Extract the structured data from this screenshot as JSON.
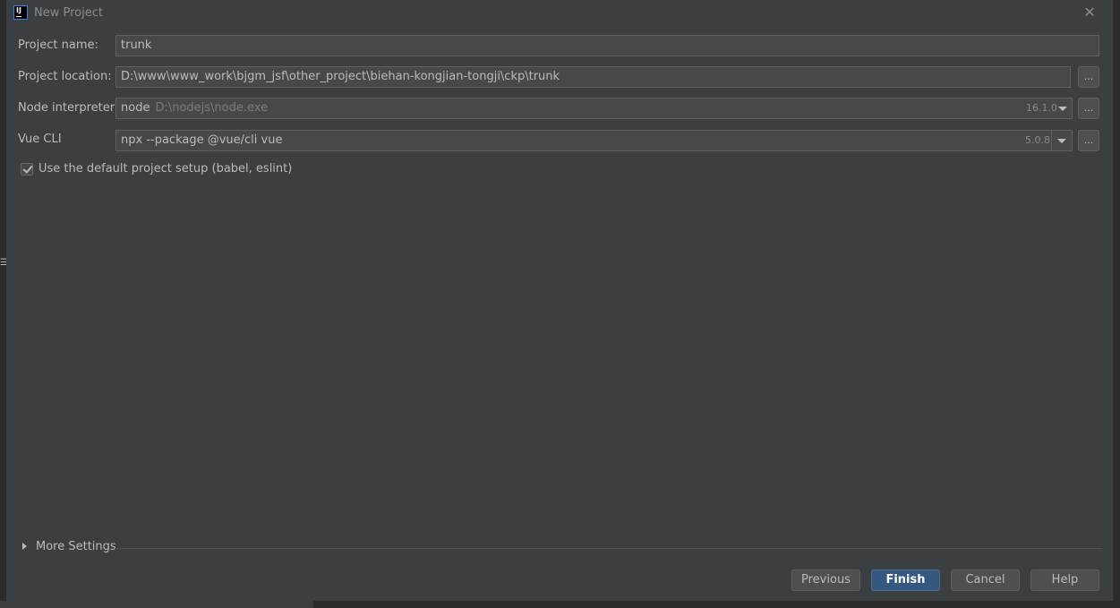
{
  "window": {
    "title": "New Project",
    "app_icon_text": "IJ"
  },
  "form": {
    "project_name": {
      "label": "Project name:",
      "value": "trunk"
    },
    "project_location": {
      "label": "Project location:",
      "value": "D:\\www\\www_work\\bjgm_jsf\\other_project\\biehan-kongjian-tongji\\ckp\\trunk",
      "browse_label": "..."
    },
    "node_interpreter": {
      "label": "Node interpreter:",
      "name": "node",
      "path": "D:\\nodejs\\node.exe",
      "version": "16.1.0",
      "browse_label": "..."
    },
    "vue_cli": {
      "label": "Vue CLI",
      "value": "npx --package @vue/cli vue",
      "version": "5.0.8",
      "browse_label": "..."
    },
    "default_setup": {
      "label": "Use the default project setup (babel, eslint)",
      "checked": true
    }
  },
  "more_settings": {
    "label": "More Settings"
  },
  "buttons": {
    "previous": "Previous",
    "finish": "Finish",
    "cancel": "Cancel",
    "help": "Help"
  },
  "colors": {
    "dialog_bg": "#3c3f41",
    "field_bg": "#45494a",
    "primary_button": "#365880",
    "text": "#bbbbbb"
  }
}
